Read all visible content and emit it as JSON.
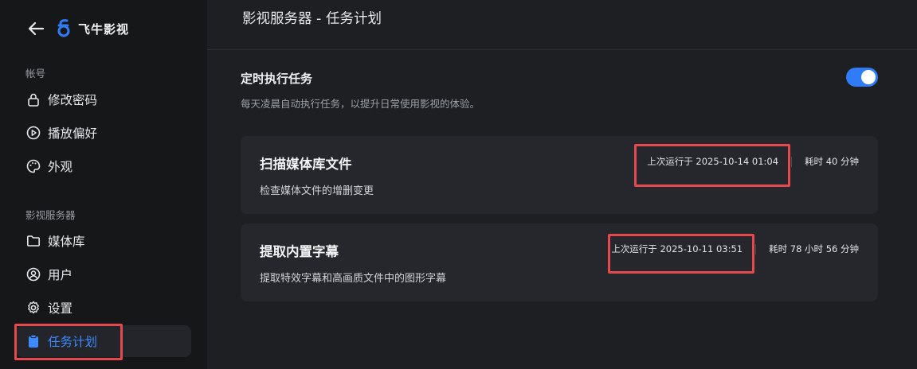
{
  "app": {
    "brand": "飞牛影视"
  },
  "sidebar": {
    "sections": [
      {
        "title": "帐号"
      },
      {
        "title": "影视服务器"
      }
    ],
    "items": [
      {
        "label": "修改密码"
      },
      {
        "label": "播放偏好"
      },
      {
        "label": "外观"
      },
      {
        "label": "媒体库"
      },
      {
        "label": "用户"
      },
      {
        "label": "设置"
      },
      {
        "label": "任务计划",
        "active": true
      }
    ]
  },
  "header": {
    "title": "影视服务器 - 任务计划"
  },
  "schedule": {
    "title": "定时执行任务",
    "description": "每天凌晨自动执行任务，以提升日常使用影视的体验。",
    "enabled": true
  },
  "tasks": [
    {
      "title": "扫描媒体库文件",
      "description": "检查媒体文件的增删变更",
      "last_run": "上次运行于 2025-10-14 01:04",
      "duration": "耗时 40 分钟"
    },
    {
      "title": "提取内置字幕",
      "description": "提取特效字幕和高画质文件中的图形字幕",
      "last_run": "上次运行于 2025-10-11 03:51",
      "duration": "耗时 78 小时 56 分钟"
    }
  ],
  "colors": {
    "accent": "#2f7cf6",
    "highlight_box": "#e5484d",
    "background": "#1d1f23",
    "sidebar": "#161719",
    "card": "#25272c"
  }
}
